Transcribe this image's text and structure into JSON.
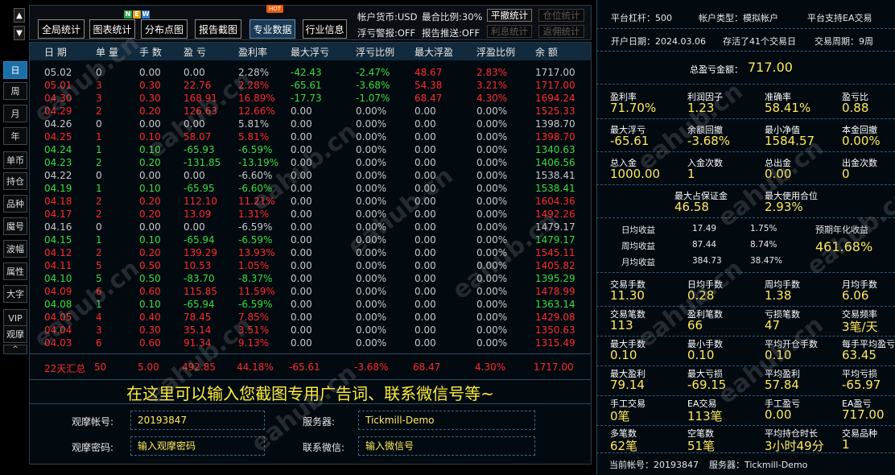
{
  "nav": {
    "up_arrow": "▲",
    "down_arrow": "▼",
    "collapse": "^"
  },
  "side_buttons": [
    "日",
    "周",
    "月",
    "年",
    "单币",
    "持仓",
    "品种",
    "魔号",
    "波幅",
    "属性",
    "大字",
    "VIP",
    "观摩"
  ],
  "toolbar": {
    "buttons": [
      "全局统计",
      "图表统计",
      "分布点图",
      "报告截图",
      "专业数据",
      "行业信息"
    ],
    "new_badge": [
      "N",
      "E",
      "W"
    ],
    "hot_badge": "HOT",
    "currency": "帐户货币:USD",
    "max_ratio": "最合比例:30%",
    "float_alarm": "浮亏警报:OFF",
    "report_push": "报告推送:OFF",
    "cancel_stats": "平撤统计",
    "position_stats": "仓位统计",
    "interest_stats": "利息统计",
    "rebate_stats": "返佣统计"
  },
  "table": {
    "headers": [
      "日 期",
      "单 量",
      "手 数",
      "盈 亏",
      "盈利率",
      "最大浮亏",
      "浮亏比例",
      "最大浮盈",
      "浮盈比例",
      "余 额"
    ],
    "rows": [
      {
        "cells": [
          "05.02",
          "0",
          "0.00",
          "0.00",
          "2.28%",
          "-42.43",
          "-2.47%",
          "48.67",
          "2.83%",
          "1717.00"
        ],
        "colors": [
          "w",
          "w",
          "w",
          "w",
          "w",
          "g",
          "g",
          "r",
          "r",
          "w"
        ]
      },
      {
        "cells": [
          "05.01",
          "3",
          "0.30",
          "22.76",
          "2.28%",
          "-65.61",
          "-3.68%",
          "54.38",
          "3.21%",
          "1717.00"
        ],
        "colors": [
          "r",
          "r",
          "r",
          "r",
          "r",
          "g",
          "g",
          "r",
          "r",
          "r"
        ]
      },
      {
        "cells": [
          "04.30",
          "3",
          "0.30",
          "168.91",
          "16.89%",
          "-17.73",
          "-1.07%",
          "68.47",
          "4.30%",
          "1694.24"
        ],
        "colors": [
          "r",
          "r",
          "r",
          "r",
          "r",
          "g",
          "g",
          "r",
          "r",
          "r"
        ]
      },
      {
        "cells": [
          "04.29",
          "2",
          "0.20",
          "126.63",
          "12.66%",
          "0.00",
          "0.00%",
          "0.00",
          "0.00%",
          "1525.33"
        ],
        "colors": [
          "r",
          "r",
          "r",
          "r",
          "r",
          "w",
          "w",
          "w",
          "w",
          "r"
        ]
      },
      {
        "cells": [
          "04.26",
          "0",
          "0.00",
          "0.00",
          "5.81%",
          "0.00",
          "0.00%",
          "0.00",
          "0.00%",
          "1398.70"
        ],
        "colors": [
          "w",
          "w",
          "w",
          "w",
          "w",
          "w",
          "w",
          "w",
          "w",
          "w"
        ]
      },
      {
        "cells": [
          "04.25",
          "1",
          "0.10",
          "58.07",
          "5.81%",
          "0.00",
          "0.00%",
          "0.00",
          "0.00%",
          "1398.70"
        ],
        "colors": [
          "r",
          "r",
          "r",
          "r",
          "r",
          "w",
          "w",
          "w",
          "w",
          "r"
        ]
      },
      {
        "cells": [
          "04.24",
          "1",
          "0.10",
          "-65.93",
          "-6.59%",
          "0.00",
          "0.00%",
          "0.00",
          "0.00%",
          "1340.63"
        ],
        "colors": [
          "g",
          "g",
          "g",
          "g",
          "g",
          "w",
          "w",
          "w",
          "w",
          "g"
        ]
      },
      {
        "cells": [
          "04.23",
          "2",
          "0.20",
          "-131.85",
          "-13.19%",
          "0.00",
          "0.00%",
          "0.00",
          "0.00%",
          "1406.56"
        ],
        "colors": [
          "g",
          "g",
          "g",
          "g",
          "g",
          "w",
          "w",
          "w",
          "w",
          "g"
        ]
      },
      {
        "cells": [
          "04.22",
          "0",
          "0.00",
          "0.00",
          "-6.60%",
          "0.00",
          "0.00%",
          "0.00",
          "0.00%",
          "1538.41"
        ],
        "colors": [
          "w",
          "w",
          "w",
          "w",
          "w",
          "w",
          "w",
          "w",
          "w",
          "w"
        ]
      },
      {
        "cells": [
          "04.19",
          "1",
          "0.10",
          "-65.95",
          "-6.60%",
          "0.00",
          "0.00%",
          "0.00",
          "0.00%",
          "1538.41"
        ],
        "colors": [
          "g",
          "g",
          "g",
          "g",
          "g",
          "w",
          "w",
          "w",
          "w",
          "g"
        ]
      },
      {
        "cells": [
          "04.18",
          "2",
          "0.20",
          "112.10",
          "11.21%",
          "0.00",
          "0.00%",
          "0.00",
          "0.00%",
          "1604.36"
        ],
        "colors": [
          "r",
          "r",
          "r",
          "r",
          "r",
          "w",
          "w",
          "w",
          "w",
          "r"
        ]
      },
      {
        "cells": [
          "04.17",
          "2",
          "0.20",
          "13.09",
          "1.31%",
          "0.00",
          "0.00%",
          "0.00",
          "0.00%",
          "1492.26"
        ],
        "colors": [
          "r",
          "r",
          "r",
          "r",
          "r",
          "w",
          "w",
          "w",
          "w",
          "r"
        ]
      },
      {
        "cells": [
          "04.16",
          "0",
          "0.00",
          "0.00",
          "-6.59%",
          "0.00",
          "0.00%",
          "0.00",
          "0.00%",
          "1479.17"
        ],
        "colors": [
          "w",
          "w",
          "w",
          "w",
          "w",
          "w",
          "w",
          "w",
          "w",
          "w"
        ]
      },
      {
        "cells": [
          "04.15",
          "1",
          "0.10",
          "-65.94",
          "-6.59%",
          "0.00",
          "0.00%",
          "0.00",
          "0.00%",
          "1479.17"
        ],
        "colors": [
          "g",
          "g",
          "g",
          "g",
          "g",
          "w",
          "w",
          "w",
          "w",
          "g"
        ]
      },
      {
        "cells": [
          "04.12",
          "2",
          "0.20",
          "139.29",
          "13.93%",
          "0.00",
          "0.00%",
          "0.00",
          "0.00%",
          "1545.11"
        ],
        "colors": [
          "r",
          "r",
          "r",
          "r",
          "r",
          "w",
          "w",
          "w",
          "w",
          "r"
        ]
      },
      {
        "cells": [
          "04.11",
          "5",
          "0.50",
          "10.53",
          "1.05%",
          "0.00",
          "0.00%",
          "0.00",
          "0.00%",
          "1405.82"
        ],
        "colors": [
          "r",
          "r",
          "r",
          "r",
          "r",
          "w",
          "w",
          "w",
          "w",
          "r"
        ]
      },
      {
        "cells": [
          "04.10",
          "5",
          "0.50",
          "-83.70",
          "-8.37%",
          "0.00",
          "0.00%",
          "0.00",
          "0.00%",
          "1395.29"
        ],
        "colors": [
          "g",
          "g",
          "g",
          "g",
          "g",
          "w",
          "w",
          "w",
          "w",
          "g"
        ]
      },
      {
        "cells": [
          "04.09",
          "6",
          "0.60",
          "115.85",
          "11.59%",
          "0.00",
          "0.00%",
          "0.00",
          "0.00%",
          "1478.99"
        ],
        "colors": [
          "r",
          "r",
          "r",
          "r",
          "r",
          "w",
          "w",
          "w",
          "w",
          "r"
        ]
      },
      {
        "cells": [
          "04.08",
          "1",
          "0.10",
          "-65.94",
          "-6.59%",
          "0.00",
          "0.00%",
          "0.00",
          "0.00%",
          "1363.14"
        ],
        "colors": [
          "g",
          "g",
          "g",
          "g",
          "g",
          "w",
          "w",
          "w",
          "w",
          "g"
        ]
      },
      {
        "cells": [
          "04.05",
          "4",
          "0.40",
          "78.45",
          "7.85%",
          "0.00",
          "0.00%",
          "0.00",
          "0.00%",
          "1429.08"
        ],
        "colors": [
          "r",
          "r",
          "r",
          "r",
          "r",
          "w",
          "w",
          "w",
          "w",
          "r"
        ]
      },
      {
        "cells": [
          "04.04",
          "3",
          "0.30",
          "35.14",
          "3.51%",
          "0.00",
          "0.00%",
          "0.00",
          "0.00%",
          "1350.63"
        ],
        "colors": [
          "r",
          "r",
          "r",
          "r",
          "r",
          "w",
          "w",
          "w",
          "w",
          "r"
        ]
      },
      {
        "cells": [
          "04.03",
          "6",
          "0.60",
          "91.34",
          "9.13%",
          "0.00",
          "0.00%",
          "0.00",
          "0.00%",
          "1315.49"
        ],
        "colors": [
          "r",
          "r",
          "r",
          "r",
          "r",
          "w",
          "w",
          "w",
          "w",
          "r"
        ]
      }
    ],
    "summary": {
      "cells": [
        "22天汇总",
        "50",
        "5.00",
        "492.85",
        "44.18%",
        "-65.61",
        "-3.68%",
        "68.47",
        "4.30%",
        "1717.00"
      ],
      "colors": [
        "r",
        "r",
        "r",
        "r",
        "r",
        "r",
        "r",
        "r",
        "r",
        "r"
      ]
    }
  },
  "ad_text": "在这里可以输入您截图专用广告词、联系微信号等~",
  "form": {
    "account_label": "观摩帐号:",
    "account_value": "20193847",
    "server_label": "服务器:",
    "server_value": "Tickmill-Demo",
    "password_label": "观摩密码:",
    "password_placeholder": "输入观摩密码",
    "wechat_label": "联系微信:",
    "wechat_placeholder": "输入微信号"
  },
  "watermark": "eahub.cn",
  "right": {
    "leverage": "平台杠杆：500",
    "account_type": "帐户类型：模拟帐户",
    "ea_support": "平台支持EA交易",
    "open_date": "开户日期：2024.03.06",
    "days": "存活了41个交易日",
    "period": "交易周期：9周",
    "total_pl_label": "总盈亏金额：",
    "total_pl_value": "717.00",
    "grid1": [
      {
        "label": "盈利率",
        "value": "71.70%"
      },
      {
        "label": "利润因子",
        "value": "1.23"
      },
      {
        "label": "准确率",
        "value": "58.41%"
      },
      {
        "label": "盈亏比",
        "value": "0.88"
      },
      {
        "label": "最大浮亏",
        "value": "-65.61"
      },
      {
        "label": "余额回撤",
        "value": "-3.68%"
      },
      {
        "label": "最小净值",
        "value": "1584.57"
      },
      {
        "label": "本金回撤",
        "value": "0.00%"
      },
      {
        "label": "总入金",
        "value": "1000.00"
      },
      {
        "label": "入金次数",
        "value": "1"
      },
      {
        "label": "总出金",
        "value": "0.00"
      },
      {
        "label": "出金次数",
        "value": "0"
      }
    ],
    "margin": [
      {
        "label": "最大占保证金",
        "value": "46.58"
      },
      {
        "label": "最大使用合位",
        "value": "2.93%"
      }
    ],
    "avg": [
      {
        "label": "日均收益",
        "value": "17.49",
        "pct": "1.75%"
      },
      {
        "label": "周均收益",
        "value": "87.44",
        "pct": "8.74%"
      },
      {
        "label": "月均收益",
        "value": "384.73",
        "pct": "38.47%"
      }
    ],
    "annual_label": "预期年化收益",
    "annual_value": "461.68%",
    "grid2": [
      {
        "label": "交易手数",
        "value": "11.30"
      },
      {
        "label": "日均手数",
        "value": "0.28"
      },
      {
        "label": "周均手数",
        "value": "1.38"
      },
      {
        "label": "月均手数",
        "value": "6.06"
      },
      {
        "label": "交易笔数",
        "value": "113"
      },
      {
        "label": "盈利笔数",
        "value": "66"
      },
      {
        "label": "亏损笔数",
        "value": "47"
      },
      {
        "label": "交易频率",
        "value": "3笔/天"
      },
      {
        "label": "最大手数",
        "value": "0.10"
      },
      {
        "label": "最小手数",
        "value": "0.10"
      },
      {
        "label": "平均开仓手数",
        "value": "0.10"
      },
      {
        "label": "每手平均盈亏",
        "value": "63.45"
      },
      {
        "label": "最大盈利",
        "value": "79.14"
      },
      {
        "label": "最大亏损",
        "value": "-69.15"
      },
      {
        "label": "平均盈利",
        "value": "57.84"
      },
      {
        "label": "平均亏损",
        "value": "-65.97"
      },
      {
        "label": "手工交易",
        "value": "0笔"
      },
      {
        "label": "EA交易",
        "value": "113笔"
      },
      {
        "label": "手工盈亏",
        "value": "0.00"
      },
      {
        "label": "EA盈亏",
        "value": "717.00"
      },
      {
        "label": "多笔数",
        "value": "62笔"
      },
      {
        "label": "空笔数",
        "value": "51笔"
      },
      {
        "label": "平均持仓时长",
        "value": "3小时49分"
      },
      {
        "label": "交易品种",
        "value": "1"
      }
    ],
    "current_account": "当前帐号：20193847",
    "current_server": "服务器：Tickmill-Demo"
  }
}
